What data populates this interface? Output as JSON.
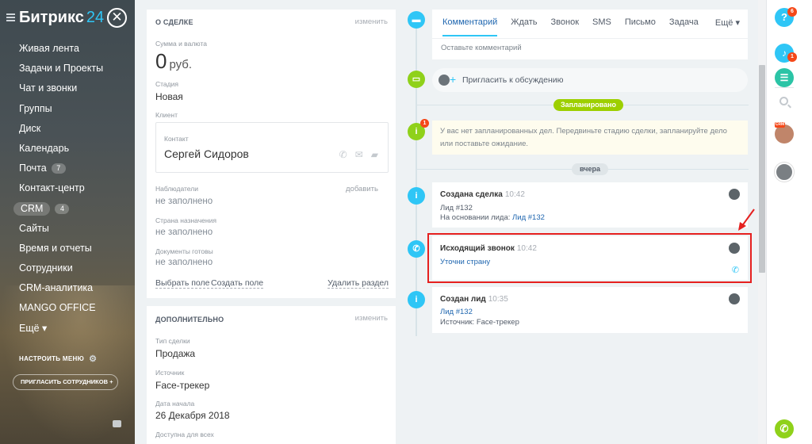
{
  "app": {
    "logo_name": "Битрикс",
    "logo_number": "24"
  },
  "sidebar": {
    "items": [
      {
        "label": "Живая лента"
      },
      {
        "label": "Задачи и Проекты"
      },
      {
        "label": "Чат и звонки"
      },
      {
        "label": "Группы"
      },
      {
        "label": "Диск"
      },
      {
        "label": "Календарь"
      },
      {
        "label": "Почта",
        "badge": "7"
      },
      {
        "label": "Контакт-центр"
      },
      {
        "label": "CRM",
        "badge": "4"
      },
      {
        "label": "Сайты"
      },
      {
        "label": "Время и отчеты"
      },
      {
        "label": "Сотрудники"
      },
      {
        "label": "CRM-аналитика"
      },
      {
        "label": "MANGO OFFICE"
      },
      {
        "label": "Ещё"
      }
    ],
    "settings_label": "НАСТРОИТЬ МЕНЮ",
    "invite_label": "ПРИГЛАСИТЬ СОТРУДНИКОВ"
  },
  "deal": {
    "title": "О СДЕЛКЕ",
    "edit_label": "изменить",
    "amount_label": "Сумма и валюта",
    "amount_value": "0",
    "currency": "руб.",
    "stage_label": "Стадия",
    "stage_value": "Новая",
    "client_label": "Клиент",
    "contact_label": "Контакт",
    "contact_name": "Сергей Сидоров",
    "observers_label": "Наблюдатели",
    "observers_add": "добавить",
    "observers_value": "не заполнено",
    "country_label": "Страна назначения",
    "country_value": "не заполнено",
    "docs_label": "Документы готовы",
    "docs_value": "не заполнено",
    "select_field": "Выбрать поле",
    "create_field": "Создать поле",
    "delete_section": "Удалить раздел"
  },
  "extra": {
    "title": "ДОПОЛНИТЕЛЬНО",
    "edit_label": "изменить",
    "type_label": "Тип сделки",
    "type_value": "Продажа",
    "source_label": "Источник",
    "source_value": "Face-трекер",
    "start_label": "Дата начала",
    "start_value": "26 Декабря 2018",
    "public_label": "Доступна для всех"
  },
  "timeline": {
    "tabs": [
      {
        "label": "Комментарий",
        "active": true
      },
      {
        "label": "Ждать"
      },
      {
        "label": "Звонок"
      },
      {
        "label": "SMS"
      },
      {
        "label": "Письмо"
      },
      {
        "label": "Задача"
      }
    ],
    "tabs_more": "Ещё",
    "comment_placeholder": "Оставьте комментарий",
    "invite_discussion": "Пригласить к обсуждению",
    "planned_label": "Запланировано",
    "planned_badge": "1",
    "notice": "У вас нет запланированных дел. Передвиньте стадию сделки, запланируйте дело или поставьте ожидание.",
    "yesterday_label": "вчера",
    "events": [
      {
        "title": "Создана сделка",
        "time": "10:42",
        "line1": "Лид #132",
        "line2_prefix": "На основании лида:",
        "line2_link": "Лид #132"
      },
      {
        "title": "Исходящий звонок",
        "time": "10:42",
        "link": "Уточни страну"
      },
      {
        "title": "Создан лид",
        "time": "10:35",
        "line1_link": "Лид #132",
        "line2": "Источник: Face-трекер"
      }
    ]
  },
  "right_panel": {
    "help_badge": "6",
    "notify_badge": "1",
    "crm_tag": "CRM"
  },
  "colors": {
    "accent": "#2fc6f6",
    "green": "#9dcf00",
    "link": "#2067b0",
    "highlight": "#e5201f"
  }
}
